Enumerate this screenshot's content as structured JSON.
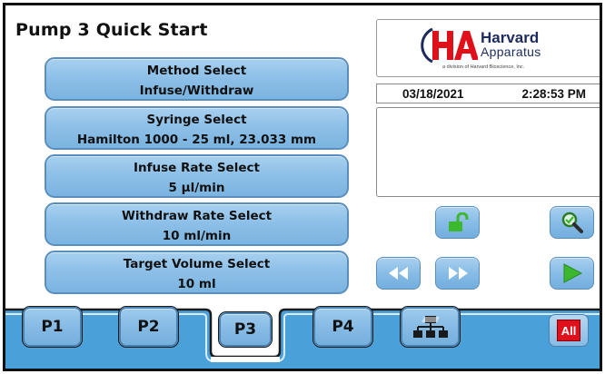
{
  "page": {
    "title": "Pump 3 Quick Start"
  },
  "selects": [
    {
      "label": "Method Select",
      "value": "Infuse/Withdraw"
    },
    {
      "label": "Syringe Select",
      "value": "Hamilton 1000 - 25 ml, 23.033 mm"
    },
    {
      "label": "Infuse Rate Select",
      "value": "5 µl/min"
    },
    {
      "label": "Withdraw Rate Select",
      "value": "10 ml/min"
    },
    {
      "label": "Target Volume Select",
      "value": "10 ml"
    }
  ],
  "logo": {
    "mark": "HA",
    "word1": "Harvard",
    "word2": "Apparatus",
    "subtitle": "a division of Harvard Bioscience, Inc."
  },
  "status": {
    "date": "03/18/2021",
    "time": "2:28:53 PM",
    "message": ""
  },
  "icons": {
    "unlock": "unlock-icon",
    "search": "magnifier-icon",
    "rewind": "rewind-icon",
    "fast_forward": "fast-forward-icon",
    "run": "play-icon",
    "network": "network-icon"
  },
  "tabs": [
    {
      "label": "P1",
      "active": false
    },
    {
      "label": "P2",
      "active": false
    },
    {
      "label": "P3",
      "active": true
    },
    {
      "label": "P4",
      "active": false
    }
  ],
  "all_button": {
    "label": "All"
  },
  "colors": {
    "button_blue": "#8ec0e8",
    "button_border": "#5a8fbd",
    "tab_strip": "#4aa0d8",
    "logo_red": "#e0101a",
    "logo_navy": "#1c2a5e",
    "icon_green": "#3cb82e"
  }
}
